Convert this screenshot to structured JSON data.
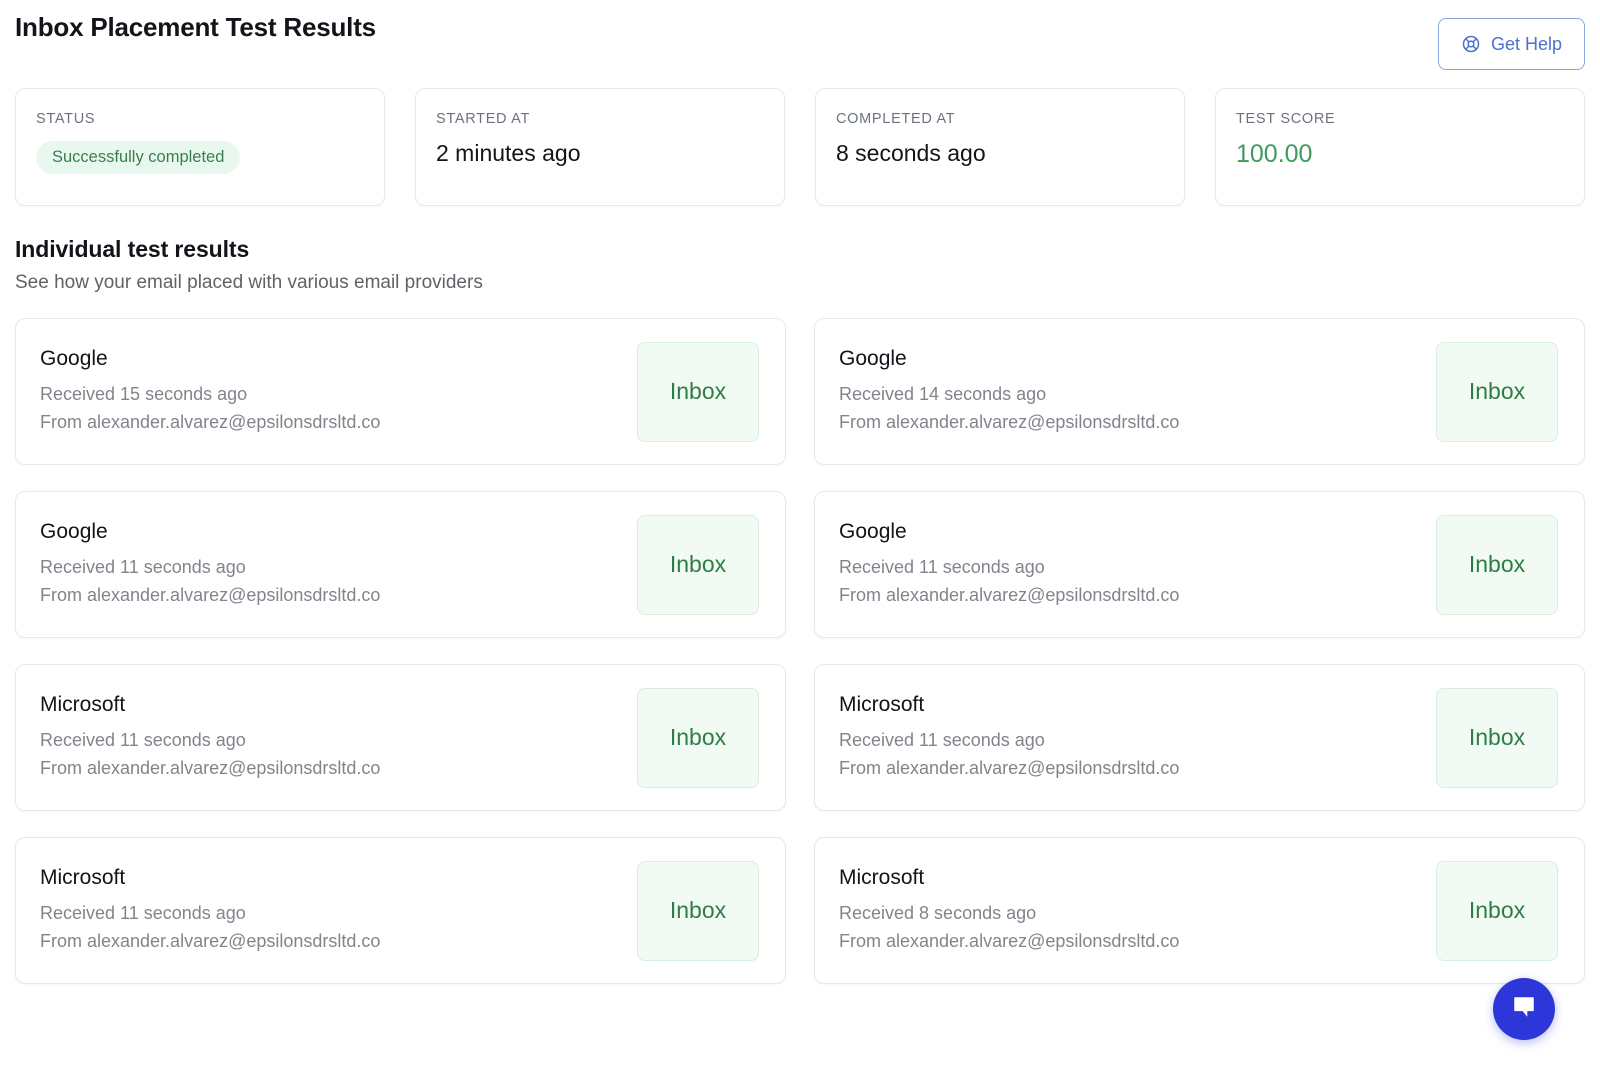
{
  "header": {
    "title": "Inbox Placement Test Results",
    "get_help_label": "Get Help",
    "get_help_icon": "lifebuoy-icon",
    "accent_color": "#4a72cf"
  },
  "stats": [
    {
      "label": "STATUS",
      "value": "Successfully completed",
      "type": "pill",
      "color": "#3b7d52",
      "bg": "#e9f8ee"
    },
    {
      "label": "STARTED AT",
      "value": "2 minutes ago",
      "type": "text",
      "color": "#111418"
    },
    {
      "label": "COMPLETED AT",
      "value": "8 seconds ago",
      "type": "text",
      "color": "#111418"
    },
    {
      "label": "TEST SCORE",
      "value": "100.00",
      "type": "score",
      "color": "#3f9a5c"
    }
  ],
  "section": {
    "title": "Individual test results",
    "subtitle": "See how your email placed with various email providers"
  },
  "results": [
    {
      "provider": "Google",
      "received": "Received 15 seconds ago",
      "from": "From alexander.alvarez@epsilonsdrsltd.co",
      "placement": "Inbox"
    },
    {
      "provider": "Google",
      "received": "Received 14 seconds ago",
      "from": "From alexander.alvarez@epsilonsdrsltd.co",
      "placement": "Inbox"
    },
    {
      "provider": "Google",
      "received": "Received 11 seconds ago",
      "from": "From alexander.alvarez@epsilonsdrsltd.co",
      "placement": "Inbox"
    },
    {
      "provider": "Google",
      "received": "Received 11 seconds ago",
      "from": "From alexander.alvarez@epsilonsdrsltd.co",
      "placement": "Inbox"
    },
    {
      "provider": "Microsoft",
      "received": "Received 11 seconds ago",
      "from": "From alexander.alvarez@epsilonsdrsltd.co",
      "placement": "Inbox"
    },
    {
      "provider": "Microsoft",
      "received": "Received 11 seconds ago",
      "from": "From alexander.alvarez@epsilonsdrsltd.co",
      "placement": "Inbox"
    },
    {
      "provider": "Microsoft",
      "received": "Received 11 seconds ago",
      "from": "From alexander.alvarez@epsilonsdrsltd.co",
      "placement": "Inbox"
    },
    {
      "provider": "Microsoft",
      "received": "Received 8 seconds ago",
      "from": "From alexander.alvarez@epsilonsdrsltd.co",
      "placement": "Inbox"
    }
  ],
  "chat_widget": {
    "icon": "chat-bubble-icon",
    "color": "#2d36d8"
  }
}
